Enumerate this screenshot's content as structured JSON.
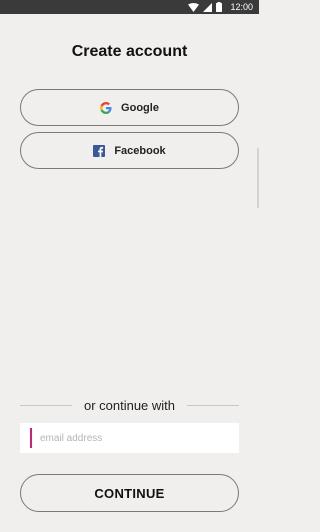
{
  "status_bar": {
    "time": "12:00",
    "icons": [
      "wifi-icon",
      "signal-icon",
      "battery-icon"
    ],
    "background": "#3a3a3a"
  },
  "title": "Create account",
  "social": {
    "google_label": "Google",
    "facebook_label": "Facebook"
  },
  "divider_text": "or continue with",
  "email": {
    "placeholder": "email address",
    "value": "",
    "caret_color": "#d81b78"
  },
  "continue_label": "CONTINUE",
  "colors": {
    "background": "#f0efed",
    "facebook_blue": "#3b5998",
    "google_blue": "#4285f4",
    "google_red": "#ea4335",
    "google_yellow": "#fbbc05",
    "google_green": "#34a853"
  }
}
